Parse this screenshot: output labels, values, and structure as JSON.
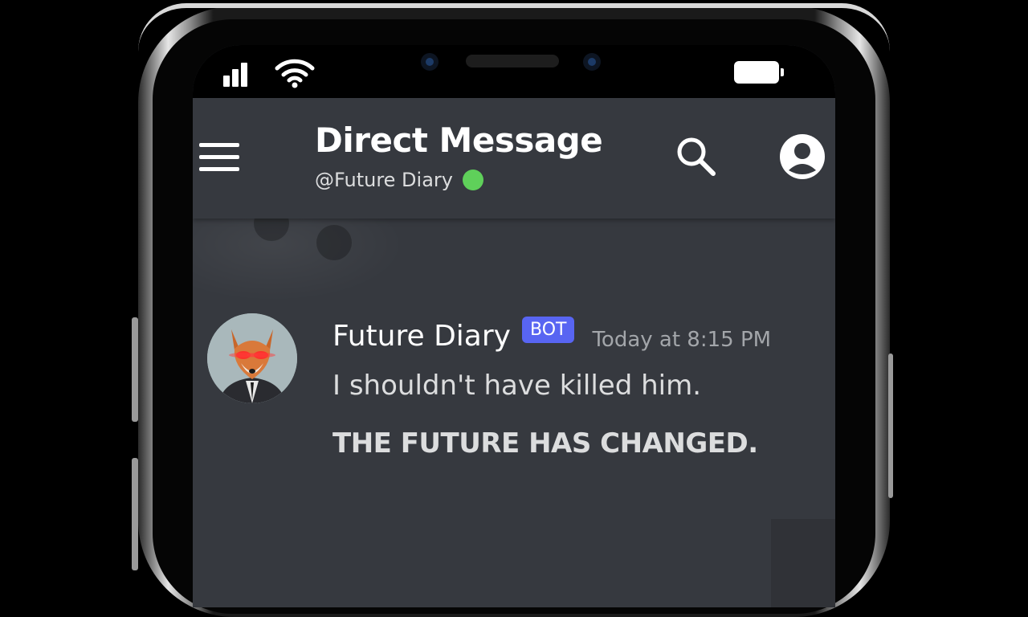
{
  "status_bar": {
    "signal_icon": "signal-bars-icon",
    "wifi_icon": "wifi-icon",
    "battery_icon": "battery-icon"
  },
  "header": {
    "title": "Direct Message",
    "subtitle": "@Future Diary",
    "status_color": "#5fd05a",
    "menu_icon": "hamburger-menu-icon",
    "search_icon": "search-icon",
    "profile_icon": "user-profile-icon"
  },
  "message": {
    "author": "Future Diary",
    "badge": "BOT",
    "timestamp": "Today at 8:15 PM",
    "line1": "I shouldn't have killed him.",
    "line2": "THE FUTURE HAS CHANGED."
  },
  "colors": {
    "background": "#36393f",
    "bot_badge": "#5865f2",
    "online": "#5fd05a"
  }
}
